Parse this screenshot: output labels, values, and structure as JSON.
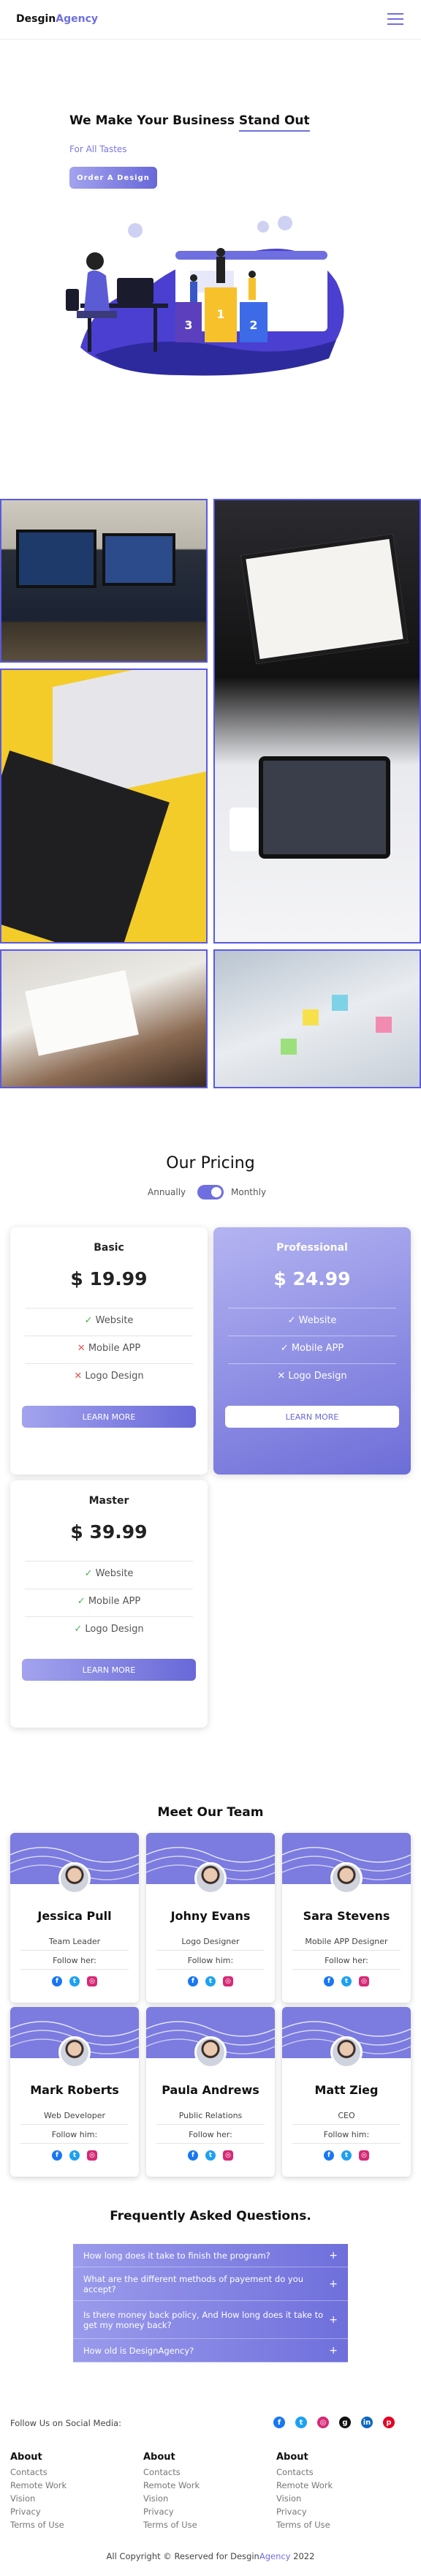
{
  "header": {
    "logo_main": "Desgin",
    "logo_accent": "Agency",
    "menu_icon": "hamburger-menu-icon"
  },
  "hero": {
    "title_plain": "We Make Your Business ",
    "title_underlined": "Stand Out",
    "subtitle": "For All Tastes",
    "cta": "Order A Design",
    "podium": [
      "3",
      "1",
      "2"
    ]
  },
  "gallery": {
    "photos": [
      "monitor-desk-photo",
      "digital-products-laptop-photo",
      "keyboard-yellow-desk-photo",
      "wireframe-sketch-photo",
      "team-sticky-notes-photo"
    ]
  },
  "pricing": {
    "title": "Our Pricing",
    "toggle_left": "Annually",
    "toggle_right": "Monthly",
    "plans": [
      {
        "name": "Basic",
        "price": "$ 19.99",
        "features": [
          {
            "mark": "✓",
            "label": "Website"
          },
          {
            "mark": "✕",
            "label": "Mobile APP"
          },
          {
            "mark": "✕",
            "label": "Logo Design"
          }
        ],
        "cta": "LEARN MORE"
      },
      {
        "name": "Professional",
        "price": "$ 24.99",
        "features": [
          {
            "mark": "✓",
            "label": "Website"
          },
          {
            "mark": "✓",
            "label": "Mobile APP"
          },
          {
            "mark": "✕",
            "label": "Logo Design"
          }
        ],
        "cta": "LEARN MORE"
      },
      {
        "name": "Master",
        "price": "$ 39.99",
        "features": [
          {
            "mark": "✓",
            "label": "Website"
          },
          {
            "mark": "✓",
            "label": "Mobile APP"
          },
          {
            "mark": "✓",
            "label": "Logo Design"
          }
        ],
        "cta": "LEARN MORE"
      }
    ]
  },
  "team": {
    "title": "Meet Our Team",
    "members": [
      {
        "name": "Jessica Pull",
        "role": "Team Leader",
        "follow": "Follow her:"
      },
      {
        "name": "Johny Evans",
        "role": "Logo Designer",
        "follow": "Follow him:"
      },
      {
        "name": "Sara Stevens",
        "role": "Mobile APP Designer",
        "follow": "Follow her:"
      },
      {
        "name": "Mark Roberts",
        "role": "Web Developer",
        "follow": "Follow him:"
      },
      {
        "name": "Paula Andrews",
        "role": "Public Relations",
        "follow": "Follow her:"
      },
      {
        "name": "Matt Zieg",
        "role": "CEO",
        "follow": "Follow him:"
      }
    ]
  },
  "faq": {
    "title": "Frequently Asked Questions.",
    "items": [
      "How long does it take to finish the program?",
      "What are the different methods of payement do you accept?",
      "Is there money back policy, And How long does it take to get my money back?",
      "How old is DesignAgency?"
    ]
  },
  "footer": {
    "social_label": "Follow Us on Social Media:",
    "columns": [
      {
        "heading": "About",
        "links": [
          "Contacts",
          "Remote Work",
          "Vision",
          "Privacy",
          "Terms of Use"
        ]
      },
      {
        "heading": "About",
        "links": [
          "Contacts",
          "Remote Work",
          "Vision",
          "Privacy",
          "Terms of Use"
        ]
      },
      {
        "heading": "About",
        "links": [
          "Contacts",
          "Remote Work",
          "Vision",
          "Privacy",
          "Terms of Use"
        ]
      }
    ],
    "copyright_pre": "All Copyright © Reserved for Desgin",
    "copyright_accent": "Agency",
    "copyright_post": " 2022"
  },
  "colors": {
    "accent": "#6f6fe0",
    "check": "#4caf50",
    "cross": "#e05555"
  }
}
